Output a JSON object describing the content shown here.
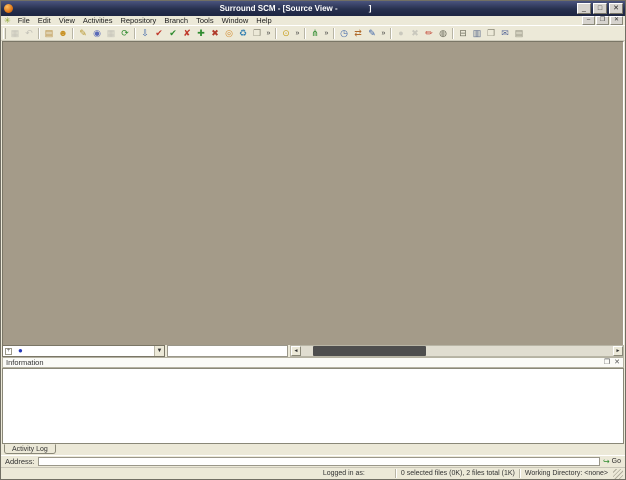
{
  "window": {
    "title": "Surround SCM - [Source View -              ]"
  },
  "titlebar": {
    "minimize": "_",
    "maximize": "□",
    "close": "✕"
  },
  "menubar": {
    "items": [
      "File",
      "Edit",
      "View",
      "Activities",
      "Repository",
      "Branch",
      "Tools",
      "Window",
      "Help"
    ],
    "child_minimize": "–",
    "child_restore": "❐",
    "child_close": "✕"
  },
  "toolbar": {
    "buttons": [
      {
        "name": "columns-view-button",
        "glyph": "▦",
        "color": "#8a8878",
        "disabled": true
      },
      {
        "name": "undo-button",
        "glyph": "↶",
        "color": "#8a8878",
        "disabled": true
      },
      {
        "type": "sep"
      },
      {
        "name": "new-repository-button",
        "glyph": "▤",
        "color": "#b5893a"
      },
      {
        "name": "user-button",
        "glyph": "☻",
        "color": "#c89020"
      },
      {
        "type": "sep"
      },
      {
        "name": "working-directory-button",
        "glyph": "✎",
        "color": "#b8962e"
      },
      {
        "name": "web-view-button",
        "glyph": "◉",
        "color": "#5a6ab8"
      },
      {
        "name": "grid-view-button",
        "glyph": "▦",
        "color": "#8a8878",
        "disabled": true
      },
      {
        "name": "refresh-button",
        "glyph": "⟳",
        "color": "#2e8b2e"
      },
      {
        "type": "sep"
      },
      {
        "name": "get-files-button",
        "glyph": "⇩",
        "color": "#3a62a8"
      },
      {
        "name": "check-out-button",
        "glyph": "✔",
        "color": "#c0392b"
      },
      {
        "name": "check-in-button",
        "glyph": "✔",
        "color": "#2e8b2e"
      },
      {
        "name": "undo-check-out-button",
        "glyph": "✘",
        "color": "#c0392b"
      },
      {
        "name": "add-files-button",
        "glyph": "✚",
        "color": "#2e8b2e"
      },
      {
        "name": "remove-files-button",
        "glyph": "✖",
        "color": "#b03a2a"
      },
      {
        "name": "label-button",
        "glyph": "◎",
        "color": "#d28a2a"
      },
      {
        "name": "promote-button",
        "glyph": "♻",
        "color": "#2e7db0"
      },
      {
        "name": "share-button",
        "glyph": "❐",
        "color": "#8a8878"
      },
      {
        "name": "more-file-actions-chevron",
        "glyph": "»",
        "type": "chevron"
      },
      {
        "type": "sep"
      },
      {
        "name": "lock-button",
        "glyph": "⊙",
        "color": "#c8a020"
      },
      {
        "name": "more-lock-actions-chevron",
        "glyph": "»",
        "type": "chevron"
      },
      {
        "type": "sep"
      },
      {
        "name": "branch-button",
        "glyph": "⋔",
        "color": "#2e8b2e"
      },
      {
        "name": "more-branch-actions-chevron",
        "glyph": "»",
        "type": "chevron"
      },
      {
        "type": "sep"
      },
      {
        "name": "history-button",
        "glyph": "◷",
        "color": "#3a62a8"
      },
      {
        "name": "differences-button",
        "glyph": "⇄",
        "color": "#b06a2a"
      },
      {
        "name": "edit-file-button",
        "glyph": "✎",
        "color": "#3a62a8"
      },
      {
        "name": "more-view-actions-chevron",
        "glyph": "»",
        "type": "chevron"
      },
      {
        "type": "sep"
      },
      {
        "name": "stop-button",
        "glyph": "●",
        "color": "#9a988a",
        "disabled": true
      },
      {
        "name": "delete-button",
        "glyph": "✖",
        "color": "#9a988a",
        "disabled": true
      },
      {
        "name": "annotate-button",
        "glyph": "✏",
        "color": "#c03a2a"
      },
      {
        "name": "find-button",
        "glyph": "◍",
        "color": "#6a6a5a"
      },
      {
        "type": "sep"
      },
      {
        "name": "print-button",
        "glyph": "⊟",
        "color": "#6a6a5a"
      },
      {
        "name": "report-button",
        "glyph": "▥",
        "color": "#5a6a8a"
      },
      {
        "name": "copy-button",
        "glyph": "❐",
        "color": "#8a8878"
      },
      {
        "name": "email-button",
        "glyph": "✉",
        "color": "#5a6a9a"
      },
      {
        "name": "address-book-button",
        "glyph": "▤",
        "color": "#8a8878"
      }
    ]
  },
  "source_view": {
    "expander_glyph": "+",
    "branch_icon": "●",
    "dropdown_arrow": "▼",
    "scroll_left": "◄",
    "scroll_right": "►"
  },
  "info_panel": {
    "title": "Information",
    "float_icon": "❐",
    "close_icon": "✕"
  },
  "tabs": {
    "activity_log": "Activity Log"
  },
  "address_bar": {
    "label": "Address:",
    "value": "",
    "go_icon": "↪",
    "go_label": "Go"
  },
  "status_bar": {
    "logged_in": "Logged in as:",
    "files": "0 selected files (0K), 2 files total (1K)",
    "working_dir": "Working Directory: <none>"
  }
}
